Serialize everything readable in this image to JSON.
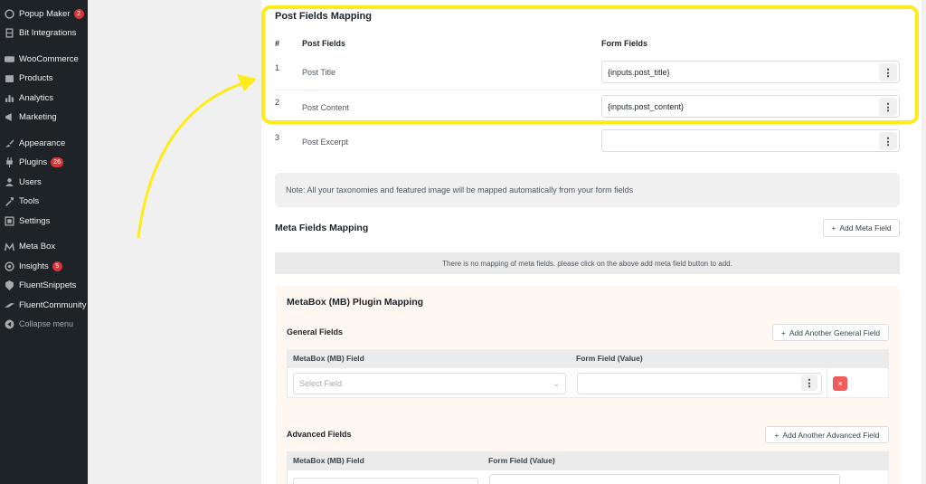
{
  "sidebar": {
    "items": [
      {
        "label": "Popup Maker",
        "icon": "popup-icon",
        "badge": "2"
      },
      {
        "label": "Bit Integrations",
        "icon": "bit-icon",
        "badge": ""
      },
      {
        "label": "WooCommerce",
        "icon": "woo-icon",
        "badge": ""
      },
      {
        "label": "Products",
        "icon": "products-icon",
        "badge": ""
      },
      {
        "label": "Analytics",
        "icon": "analytics-icon",
        "badge": ""
      },
      {
        "label": "Marketing",
        "icon": "marketing-icon",
        "badge": ""
      },
      {
        "label": "Appearance",
        "icon": "appearance-icon",
        "badge": ""
      },
      {
        "label": "Plugins",
        "icon": "plugins-icon",
        "badge": "26"
      },
      {
        "label": "Users",
        "icon": "users-icon",
        "badge": ""
      },
      {
        "label": "Tools",
        "icon": "tools-icon",
        "badge": ""
      },
      {
        "label": "Settings",
        "icon": "settings-icon",
        "badge": ""
      },
      {
        "label": "Meta Box",
        "icon": "metabox-icon",
        "badge": ""
      },
      {
        "label": "Insights",
        "icon": "insights-icon",
        "badge": "5"
      },
      {
        "label": "FluentSnippets",
        "icon": "snippets-icon",
        "badge": ""
      },
      {
        "label": "FluentCommunity",
        "icon": "community-icon",
        "badge": ""
      },
      {
        "label": "Collapse menu",
        "icon": "collapse-icon",
        "badge": ""
      }
    ]
  },
  "post_fields": {
    "title": "Post Fields Mapping",
    "col_num": "#",
    "col_post": "Post Fields",
    "col_form": "Form Fields",
    "rows": [
      {
        "num": "1",
        "label": "Post Title",
        "value": "{inputs.post_title}"
      },
      {
        "num": "2",
        "label": "Post Content",
        "value": "{inputs.post_content}"
      },
      {
        "num": "3",
        "label": "Post Excerpt",
        "value": ""
      }
    ],
    "note": "Note: All your taxonomies and featured image will be mapped automatically from your form fields"
  },
  "meta_fields": {
    "title": "Meta Fields Mapping",
    "add_button": "Add Meta Field",
    "empty_text": "There is no mapping of meta fields. please click on the above add meta field button to add."
  },
  "metabox": {
    "title": "MetaBox (MB) Plugin Mapping",
    "general": {
      "title": "General Fields",
      "add_button": "Add Another General Field",
      "col_field": "MetaBox (MB) Field",
      "col_value": "Form Field (Value)",
      "select_placeholder": "Select Field"
    },
    "advanced": {
      "title": "Advanced Fields",
      "add_button": "Add Another Advanced Field",
      "col_field": "MetaBox (MB) Field",
      "col_value": "Form Field (Value)"
    }
  },
  "colors": {
    "sidebar_bg": "#1d2327",
    "highlight": "#ffeb1a",
    "badge": "#d63638",
    "delete": "#f05c5c"
  }
}
